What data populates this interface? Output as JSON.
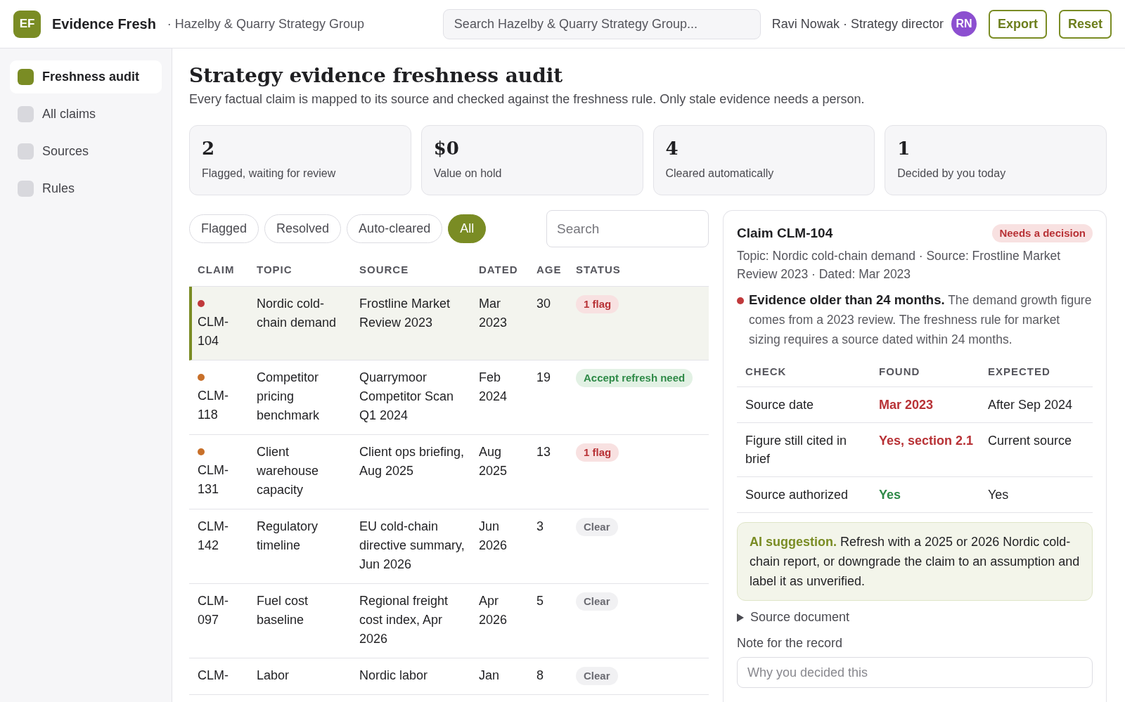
{
  "app": {
    "logo": "EF",
    "name": "Evidence Fresh",
    "org": "· Hazelby & Quarry Strategy Group"
  },
  "search": {
    "placeholder": "Search Hazelby & Quarry Strategy Group..."
  },
  "user": {
    "label": "Ravi Nowak · Strategy director",
    "initials": "RN"
  },
  "actions": [
    "Export",
    "Reset"
  ],
  "sidebar": {
    "items": [
      {
        "label": "Freshness audit",
        "selected": true
      },
      {
        "label": "All claims",
        "selected": false
      },
      {
        "label": "Sources",
        "selected": false
      },
      {
        "label": "Rules",
        "selected": false
      }
    ]
  },
  "page": {
    "title": "Strategy evidence freshness audit",
    "subtitle": "Every factual claim is mapped to its source and checked against the freshness rule. Only stale evidence needs a person."
  },
  "stats": [
    {
      "value": "2",
      "label": "Flagged, waiting for review"
    },
    {
      "value": "$0",
      "label": "Value on hold"
    },
    {
      "value": "4",
      "label": "Cleared automatically"
    },
    {
      "value": "1",
      "label": "Decided by you today"
    }
  ],
  "filters": [
    {
      "label": "Flagged",
      "selected": false
    },
    {
      "label": "Resolved",
      "selected": false
    },
    {
      "label": "Auto-cleared",
      "selected": false
    },
    {
      "label": "All",
      "selected": true
    }
  ],
  "table_search": {
    "placeholder": "Search"
  },
  "table": {
    "columns": [
      "CLAIM",
      "TOPIC",
      "SOURCE",
      "DATED",
      "AGE",
      "STATUS"
    ],
    "rows": [
      {
        "claim": "CLM-104",
        "color": "#c0393b",
        "topic": "Nordic cold-chain demand",
        "source": "Frostline Market Review 2023",
        "dated": "Mar 2023",
        "age": "30",
        "status": {
          "kind": "flag",
          "label": "1 flag"
        },
        "selected": true
      },
      {
        "claim": "CLM-118",
        "color": "#c8702a",
        "topic": "Competitor pricing benchmark",
        "source": "Quarrymoor Competitor Scan Q1 2024",
        "dated": "Feb 2024",
        "age": "19",
        "status": {
          "kind": "accepted",
          "label": "Accept refresh need"
        },
        "selected": false
      },
      {
        "claim": "CLM-131",
        "color": "#c8702a",
        "topic": "Client warehouse capacity",
        "source": "Client ops briefing, Aug 2025",
        "dated": "Aug 2025",
        "age": "13",
        "status": {
          "kind": "flag",
          "label": "1 flag"
        },
        "selected": false
      },
      {
        "claim": "CLM-142",
        "topic": "Regulatory timeline",
        "source": "EU cold-chain directive summary, Jun 2026",
        "dated": "Jun 2026",
        "age": "3",
        "status": {
          "kind": "clear",
          "label": "Clear"
        },
        "selected": false
      },
      {
        "claim": "CLM-097",
        "topic": "Fuel cost baseline",
        "source": "Regional freight cost index, Apr 2026",
        "dated": "Apr 2026",
        "age": "5",
        "status": {
          "kind": "clear",
          "label": "Clear"
        },
        "selected": false
      },
      {
        "claim": "CLM-",
        "topic": "Labor",
        "source": "Nordic labor",
        "dated": "Jan",
        "age": "8",
        "status": {
          "kind": "clear",
          "label": "Clear"
        },
        "selected": false
      }
    ]
  },
  "detail": {
    "title": "Claim CLM-104",
    "badge": "Needs a decision",
    "meta": "Topic: Nordic cold-chain demand · Source: Frostline Market Review 2023 · Dated: Mar 2023",
    "finding": {
      "color": "#c0393b",
      "text": "**Evidence older than 24 months.** The demand growth figure comes from a 2023 review. The freshness rule for market sizing requires a source dated within 24 months."
    },
    "checks": {
      "columns": [
        "CHECK",
        "FOUND",
        "EXPECTED"
      ],
      "rows": [
        {
          "check": "Source date",
          "found": "Mar 2023",
          "kind": "fail",
          "expected": "After Sep 2024"
        },
        {
          "check": "Figure still cited in brief",
          "found": "Yes, section 2.1",
          "kind": "fail",
          "expected": "Current source"
        },
        {
          "check": "Source authorized",
          "found": "Yes",
          "kind": "pass",
          "expected": "Yes"
        }
      ]
    },
    "suggestion": "**AI suggestion.** Refresh with a 2025 or 2026 Nordic cold-chain report, or downgrade the claim to an assumption and label it as unverified.",
    "source_document": {
      "label": "Source document",
      "expanded": false
    },
    "note": {
      "label": "Note for the record",
      "placeholder": "Why you decided this"
    }
  }
}
